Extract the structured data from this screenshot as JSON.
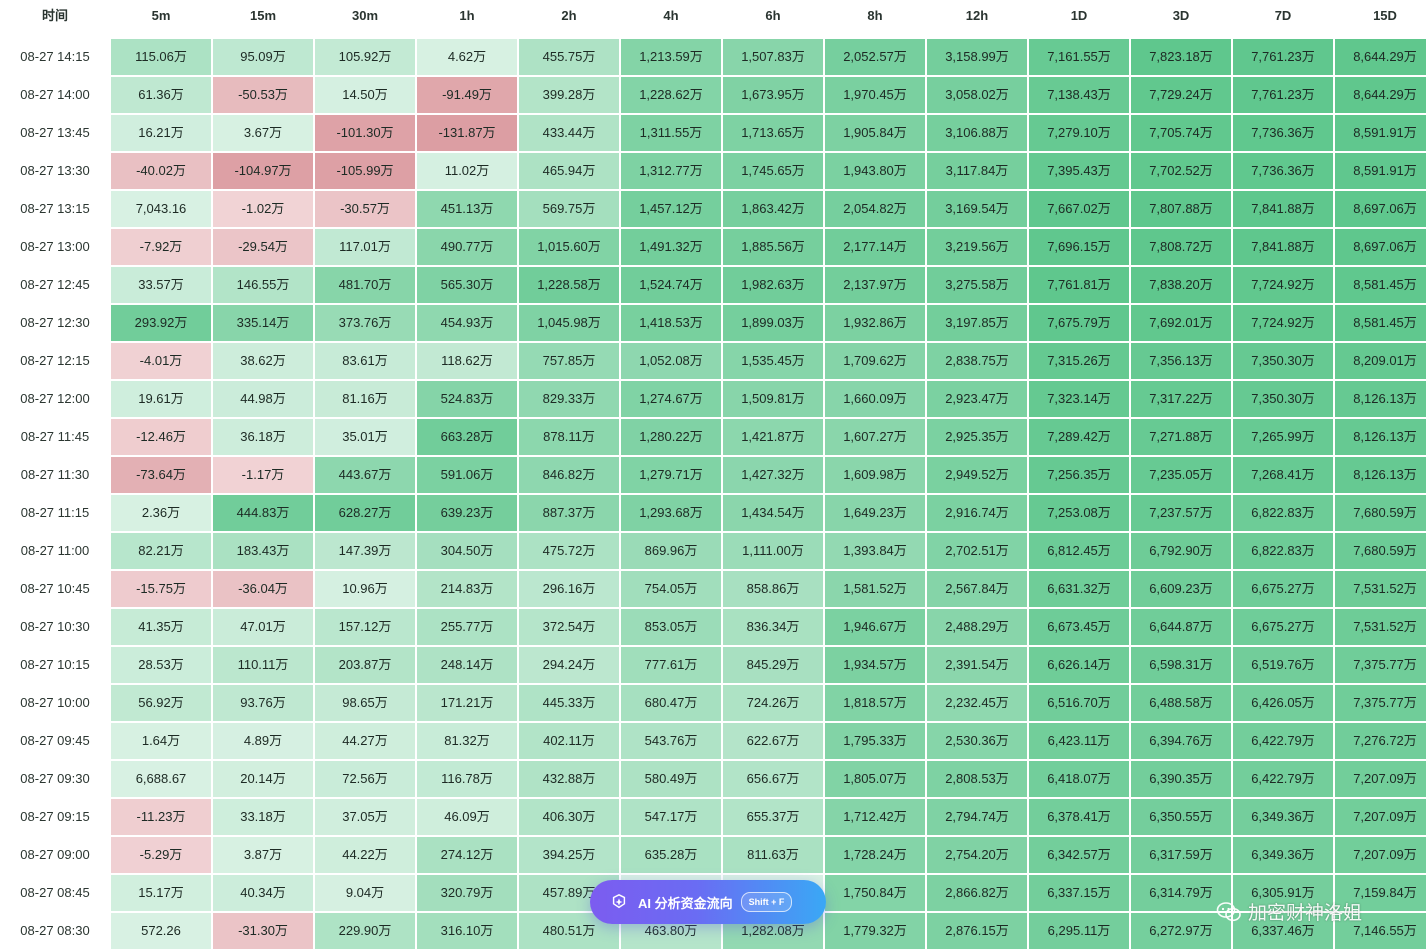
{
  "table": {
    "time_header": "时间",
    "columns": [
      "5m",
      "15m",
      "30m",
      "1h",
      "2h",
      "4h",
      "6h",
      "8h",
      "12h",
      "1D",
      "3D",
      "7D",
      "15D"
    ],
    "rows": [
      {
        "time": "08-27 14:15",
        "values": [
          "115.06万",
          "95.09万",
          "105.92万",
          "4.62万",
          "455.75万",
          "1,213.59万",
          "1,507.83万",
          "2,052.57万",
          "3,158.99万",
          "7,161.55万",
          "7,823.18万",
          "7,761.23万",
          "8,644.29万"
        ]
      },
      {
        "time": "08-27 14:00",
        "values": [
          "61.36万",
          "-50.53万",
          "14.50万",
          "-91.49万",
          "399.28万",
          "1,228.62万",
          "1,673.95万",
          "1,970.45万",
          "3,058.02万",
          "7,138.43万",
          "7,729.24万",
          "7,761.23万",
          "8,644.29万"
        ]
      },
      {
        "time": "08-27 13:45",
        "values": [
          "16.21万",
          "3.67万",
          "-101.30万",
          "-131.87万",
          "433.44万",
          "1,311.55万",
          "1,713.65万",
          "1,905.84万",
          "3,106.88万",
          "7,279.10万",
          "7,705.74万",
          "7,736.36万",
          "8,591.91万"
        ]
      },
      {
        "time": "08-27 13:30",
        "values": [
          "-40.02万",
          "-104.97万",
          "-105.99万",
          "11.02万",
          "465.94万",
          "1,312.77万",
          "1,745.65万",
          "1,943.80万",
          "3,117.84万",
          "7,395.43万",
          "7,702.52万",
          "7,736.36万",
          "8,591.91万"
        ]
      },
      {
        "time": "08-27 13:15",
        "values": [
          "7,043.16",
          "-1.02万",
          "-30.57万",
          "451.13万",
          "569.75万",
          "1,457.12万",
          "1,863.42万",
          "2,054.82万",
          "3,169.54万",
          "7,667.02万",
          "7,807.88万",
          "7,841.88万",
          "8,697.06万"
        ]
      },
      {
        "time": "08-27 13:00",
        "values": [
          "-7.92万",
          "-29.54万",
          "117.01万",
          "490.77万",
          "1,015.60万",
          "1,491.32万",
          "1,885.56万",
          "2,177.14万",
          "3,219.56万",
          "7,696.15万",
          "7,808.72万",
          "7,841.88万",
          "8,697.06万"
        ]
      },
      {
        "time": "08-27 12:45",
        "values": [
          "33.57万",
          "146.55万",
          "481.70万",
          "565.30万",
          "1,228.58万",
          "1,524.74万",
          "1,982.63万",
          "2,137.97万",
          "3,275.58万",
          "7,761.81万",
          "7,838.20万",
          "7,724.92万",
          "8,581.45万"
        ]
      },
      {
        "time": "08-27 12:30",
        "values": [
          "293.92万",
          "335.14万",
          "373.76万",
          "454.93万",
          "1,045.98万",
          "1,418.53万",
          "1,899.03万",
          "1,932.86万",
          "3,197.85万",
          "7,675.79万",
          "7,692.01万",
          "7,724.92万",
          "8,581.45万"
        ]
      },
      {
        "time": "08-27 12:15",
        "values": [
          "-4.01万",
          "38.62万",
          "83.61万",
          "118.62万",
          "757.85万",
          "1,052.08万",
          "1,535.45万",
          "1,709.62万",
          "2,838.75万",
          "7,315.26万",
          "7,356.13万",
          "7,350.30万",
          "8,209.01万"
        ]
      },
      {
        "time": "08-27 12:00",
        "values": [
          "19.61万",
          "44.98万",
          "81.16万",
          "524.83万",
          "829.33万",
          "1,274.67万",
          "1,509.81万",
          "1,660.09万",
          "2,923.47万",
          "7,323.14万",
          "7,317.22万",
          "7,350.30万",
          "8,126.13万"
        ]
      },
      {
        "time": "08-27 11:45",
        "values": [
          "-12.46万",
          "36.18万",
          "35.01万",
          "663.28万",
          "878.11万",
          "1,280.22万",
          "1,421.87万",
          "1,607.27万",
          "2,925.35万",
          "7,289.42万",
          "7,271.88万",
          "7,265.99万",
          "8,126.13万"
        ]
      },
      {
        "time": "08-27 11:30",
        "values": [
          "-73.64万",
          "-1.17万",
          "443.67万",
          "591.06万",
          "846.82万",
          "1,279.71万",
          "1,427.32万",
          "1,609.98万",
          "2,949.52万",
          "7,256.35万",
          "7,235.05万",
          "7,268.41万",
          "8,126.13万"
        ]
      },
      {
        "time": "08-27 11:15",
        "values": [
          "2.36万",
          "444.83万",
          "628.27万",
          "639.23万",
          "887.37万",
          "1,293.68万",
          "1,434.54万",
          "1,649.23万",
          "2,916.74万",
          "7,253.08万",
          "7,237.57万",
          "6,822.83万",
          "7,680.59万"
        ]
      },
      {
        "time": "08-27 11:00",
        "values": [
          "82.21万",
          "183.43万",
          "147.39万",
          "304.50万",
          "475.72万",
          "869.96万",
          "1,111.00万",
          "1,393.84万",
          "2,702.51万",
          "6,812.45万",
          "6,792.90万",
          "6,822.83万",
          "7,680.59万"
        ]
      },
      {
        "time": "08-27 10:45",
        "values": [
          "-15.75万",
          "-36.04万",
          "10.96万",
          "214.83万",
          "296.16万",
          "754.05万",
          "858.86万",
          "1,581.52万",
          "2,567.84万",
          "6,631.32万",
          "6,609.23万",
          "6,675.27万",
          "7,531.52万"
        ]
      },
      {
        "time": "08-27 10:30",
        "values": [
          "41.35万",
          "47.01万",
          "157.12万",
          "255.77万",
          "372.54万",
          "853.05万",
          "836.34万",
          "1,946.67万",
          "2,488.29万",
          "6,673.45万",
          "6,644.87万",
          "6,675.27万",
          "7,531.52万"
        ]
      },
      {
        "time": "08-27 10:15",
        "values": [
          "28.53万",
          "110.11万",
          "203.87万",
          "248.14万",
          "294.24万",
          "777.61万",
          "845.29万",
          "1,934.57万",
          "2,391.54万",
          "6,626.14万",
          "6,598.31万",
          "6,519.76万",
          "7,375.77万"
        ]
      },
      {
        "time": "08-27 10:00",
        "values": [
          "56.92万",
          "93.76万",
          "98.65万",
          "171.21万",
          "445.33万",
          "680.47万",
          "724.26万",
          "1,818.57万",
          "2,232.45万",
          "6,516.70万",
          "6,488.58万",
          "6,426.05万",
          "7,375.77万"
        ]
      },
      {
        "time": "08-27 09:45",
        "values": [
          "1.64万",
          "4.89万",
          "44.27万",
          "81.32万",
          "402.11万",
          "543.76万",
          "622.67万",
          "1,795.33万",
          "2,530.36万",
          "6,423.11万",
          "6,394.76万",
          "6,422.79万",
          "7,276.72万"
        ]
      },
      {
        "time": "08-27 09:30",
        "values": [
          "6,688.67",
          "20.14万",
          "72.56万",
          "116.78万",
          "432.88万",
          "580.49万",
          "656.67万",
          "1,805.07万",
          "2,808.53万",
          "6,418.07万",
          "6,390.35万",
          "6,422.79万",
          "7,207.09万"
        ]
      },
      {
        "time": "08-27 09:15",
        "values": [
          "-11.23万",
          "33.18万",
          "37.05万",
          "46.09万",
          "406.30万",
          "547.17万",
          "655.37万",
          "1,712.42万",
          "2,794.74万",
          "6,378.41万",
          "6,350.55万",
          "6,349.36万",
          "7,207.09万"
        ]
      },
      {
        "time": "08-27 09:00",
        "values": [
          "-5.29万",
          "3.87万",
          "44.22万",
          "274.12万",
          "394.25万",
          "635.28万",
          "811.63万",
          "1,728.24万",
          "2,754.20万",
          "6,342.57万",
          "6,317.59万",
          "6,349.36万",
          "7,207.09万"
        ]
      },
      {
        "time": "08-27 08:45",
        "values": [
          "15.17万",
          "40.34万",
          "9.04万",
          "320.79万",
          "457.89万",
          "",
          "",
          "1,750.84万",
          "2,866.82万",
          "6,337.15万",
          "6,314.79万",
          "6,305.91万",
          "7,159.84万"
        ]
      },
      {
        "time": "08-27 08:30",
        "values": [
          "572.26",
          "-31.30万",
          "229.90万",
          "316.10万",
          "480.51万",
          "463.80万",
          "1,282.08万",
          "1,779.32万",
          "2,876.15万",
          "6,295.11万",
          "6,272.97万",
          "6,337.46万",
          "7,146.55万"
        ]
      }
    ]
  },
  "ai_button": {
    "label": "AI 分析资金流向",
    "shortcut": "Shift + F",
    "icon": "ai-spark-icon"
  },
  "watermark": {
    "text": "加密财神洛姐",
    "icon": "wechat-icon"
  },
  "colors": {
    "positive_light": "#d8f1e3",
    "positive_strong": "#5fc78d",
    "negative_light": "#f1d3d5",
    "negative_strong": "#dc9ea3",
    "accent_start": "#7c5cf0",
    "accent_end": "#3aa8f5"
  }
}
